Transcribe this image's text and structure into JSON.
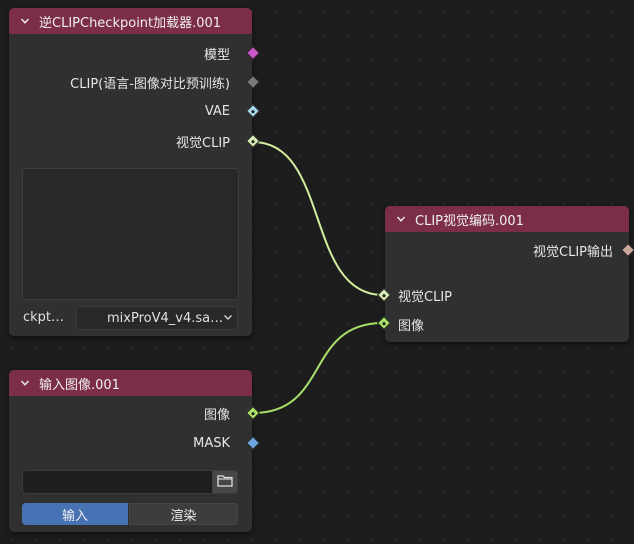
{
  "nodes": {
    "checkpoint": {
      "title": "逆CLIPCheckpoint加载器.001",
      "outputs": {
        "model": "模型",
        "clip": "CLIP(语言-图像对比预训练)",
        "vae": "VAE",
        "clip_vision": "视觉CLIP"
      },
      "ckpt_label": "ckpt…",
      "ckpt_value": "mixProV4_v4.sa…"
    },
    "clip_vision_encode": {
      "title": "CLIP视觉编码.001",
      "output": "视觉CLIP输出",
      "inputs": {
        "clip_vision": "视觉CLIP",
        "image": "图像"
      }
    },
    "input_image": {
      "title": "输入图像.001",
      "outputs": {
        "image": "图像",
        "mask": "MASK"
      },
      "tabs": {
        "input": "输入",
        "render": "渲染"
      }
    }
  },
  "colors": {
    "header": "#7b2d49",
    "node_body": "#303030",
    "socket_model": "#c957c9",
    "socket_clip": "#7a7a7a",
    "socket_vae": "#a7d7e6",
    "socket_clip_vision": "#d6ecb4",
    "socket_image": "#a8e06a",
    "socket_mask": "#6ea4e0",
    "socket_output": "#c9a69a",
    "link_clip_vision": "#d2ed9e",
    "link_image": "#a8e06a",
    "tab_active": "#4772b3"
  }
}
